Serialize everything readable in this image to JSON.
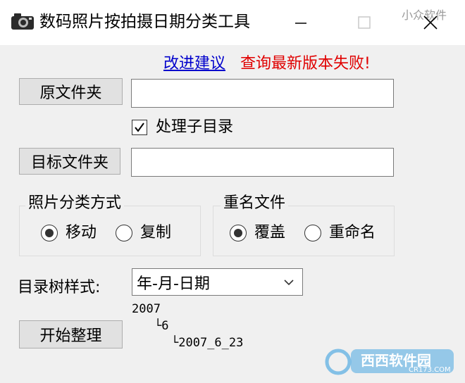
{
  "window": {
    "title": "数码照片按拍摄日期分类工具",
    "watermark_top": "小众软件",
    "controls": [
      "minimize",
      "maximize",
      "close"
    ]
  },
  "header": {
    "suggest_link": "改进建议",
    "update_status": "查询最新版本失败!"
  },
  "source": {
    "button_label": "原文件夹",
    "value": ""
  },
  "subdir": {
    "label": "处理子目录",
    "checked": true
  },
  "target": {
    "button_label": "目标文件夹",
    "value": ""
  },
  "classify": {
    "title": "照片分类方式",
    "options": [
      {
        "label": "移动",
        "selected": true
      },
      {
        "label": "复制",
        "selected": false
      }
    ]
  },
  "rename": {
    "title": "重名文件",
    "options": [
      {
        "label": "覆盖",
        "selected": true
      },
      {
        "label": "重命名",
        "selected": false
      }
    ]
  },
  "tree_style": {
    "label": "目录树样式:",
    "selected": "年-月-日期"
  },
  "preview": {
    "line1": "2007",
    "line2": "└6",
    "line3": "└2007_6_23"
  },
  "start": {
    "button_label": "开始整理"
  },
  "watermark_bottom": {
    "text": "西西软件园",
    "sub": "CR173.COM"
  },
  "colors": {
    "link": "#0000cc",
    "error": "#e00000",
    "background": "#f0f0f0"
  }
}
